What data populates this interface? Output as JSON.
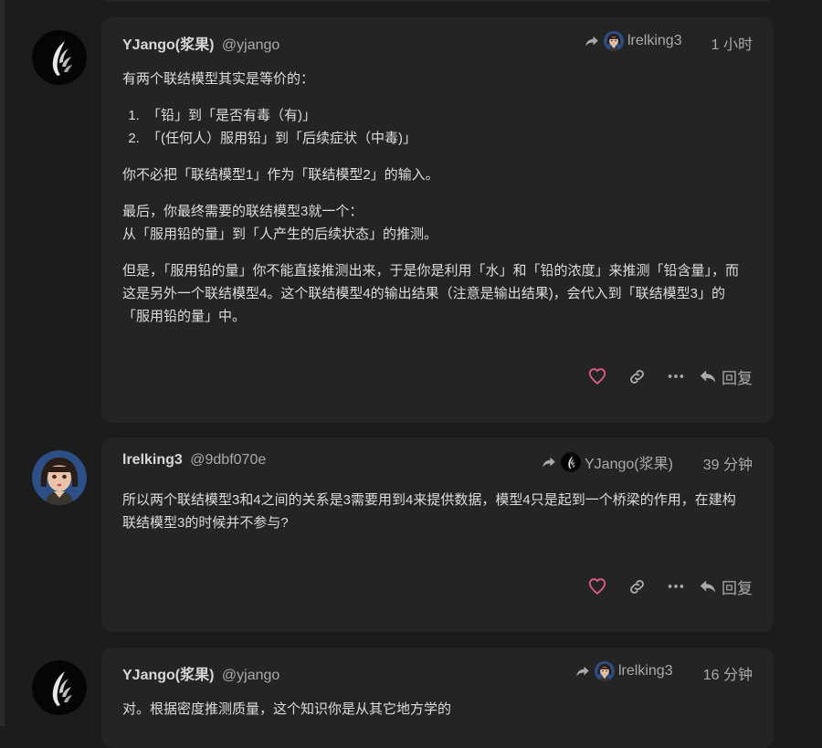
{
  "posts": [
    {
      "author": "YJango(浆果)",
      "handle": "@yjango",
      "reply_to": "lrelking3",
      "time": "1 小时",
      "intro": "有两个联结模型其实是等价的：",
      "list": [
        "「铅」到「是否有毒（有)」",
        "「(任何人）服用铅」到「后续症状（中毒)」"
      ],
      "p1": "你不必把「联结模型1」作为「联结模型2」的输入。",
      "p2a": "最后，你最终需要的联结模型3就一个：",
      "p2b": "从「服用铅的量」到「人产生的后续状态」的推测。",
      "p3": "但是，「服用铅的量」你不能直接推测出来，于是你是利用「水」和「铅的浓度」来推测「铅含量」，而这是另外一个联结模型4。这个联结模型4的输出结果（注意是输出结果)，会代入到「联结模型3」的「服用铅的量」中。",
      "reply_label": "回复"
    },
    {
      "author": "lrelking3",
      "handle": "@9dbf070e",
      "reply_to": "YJango(浆果)",
      "time": "39 分钟",
      "p1": "所以两个联结模型3和4之间的关系是3需要用到4来提供数据，模型4只是起到一个桥梁的作用，在建构联结模型3的时候并不参与?",
      "reply_label": "回复"
    },
    {
      "author": "YJango(浆果)",
      "handle": "@yjango",
      "reply_to": "lrelking3",
      "time": "16 分钟",
      "p1": "对。根据密度推测质量，这个知识你是从其它地方学的"
    }
  ],
  "icons": {
    "like": "heart-icon",
    "link": "link-icon",
    "more": "ellipsis-icon",
    "reply": "reply-arrow-icon",
    "reply_to": "share-arrow-icon"
  },
  "colors": {
    "background": "#1c1c1d",
    "card": "#242425",
    "like": "#e05d86",
    "muted": "#aaaaaa"
  }
}
